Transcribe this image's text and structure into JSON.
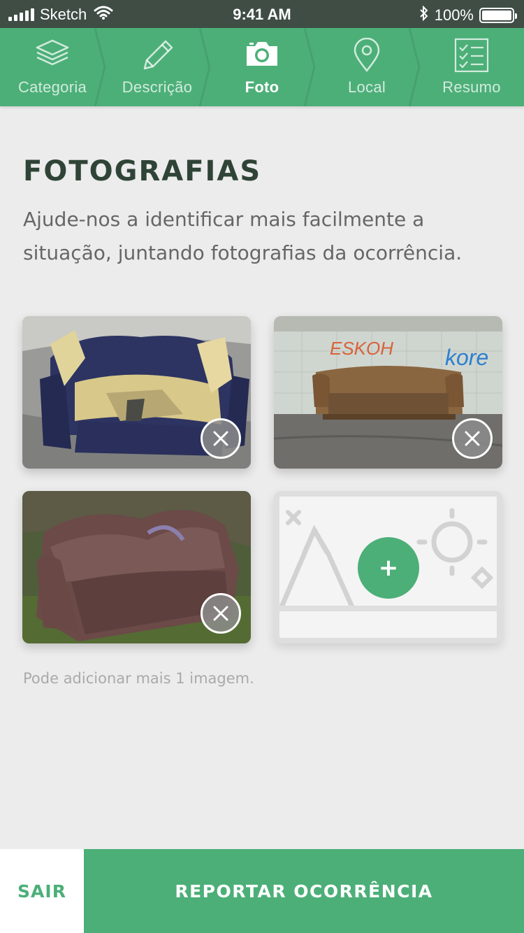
{
  "status_bar": {
    "carrier": "Sketch",
    "time": "9:41 AM",
    "battery": "100%",
    "battery_level": 1.0
  },
  "steps": [
    {
      "label": "Categoria",
      "icon": "layers-icon",
      "active": false
    },
    {
      "label": "Descrição",
      "icon": "pencil-icon",
      "active": false
    },
    {
      "label": "Foto",
      "icon": "camera-icon",
      "active": true
    },
    {
      "label": "Local",
      "icon": "location-pin-icon",
      "active": false
    },
    {
      "label": "Resumo",
      "icon": "checklist-icon",
      "active": false
    }
  ],
  "main": {
    "title": "FOTOGRAFIAS",
    "description": "Ajude-nos a identificar mais facilmente a situação, juntando fotografias da ocorrência.",
    "photos": [
      {
        "subject": "torn blue sofa"
      },
      {
        "subject": "brown sofa by graffiti wall"
      },
      {
        "subject": "brown leather sofa on grass"
      }
    ],
    "hint": "Pode adicionar mais 1 imagem."
  },
  "footer": {
    "exit_label": "SAIR",
    "report_label": "REPORTAR OCORRÊNCIA"
  },
  "colors": {
    "accent": "#4caf78",
    "status_bar": "#3f4d45",
    "title": "#2f4437",
    "background": "#ececec"
  }
}
